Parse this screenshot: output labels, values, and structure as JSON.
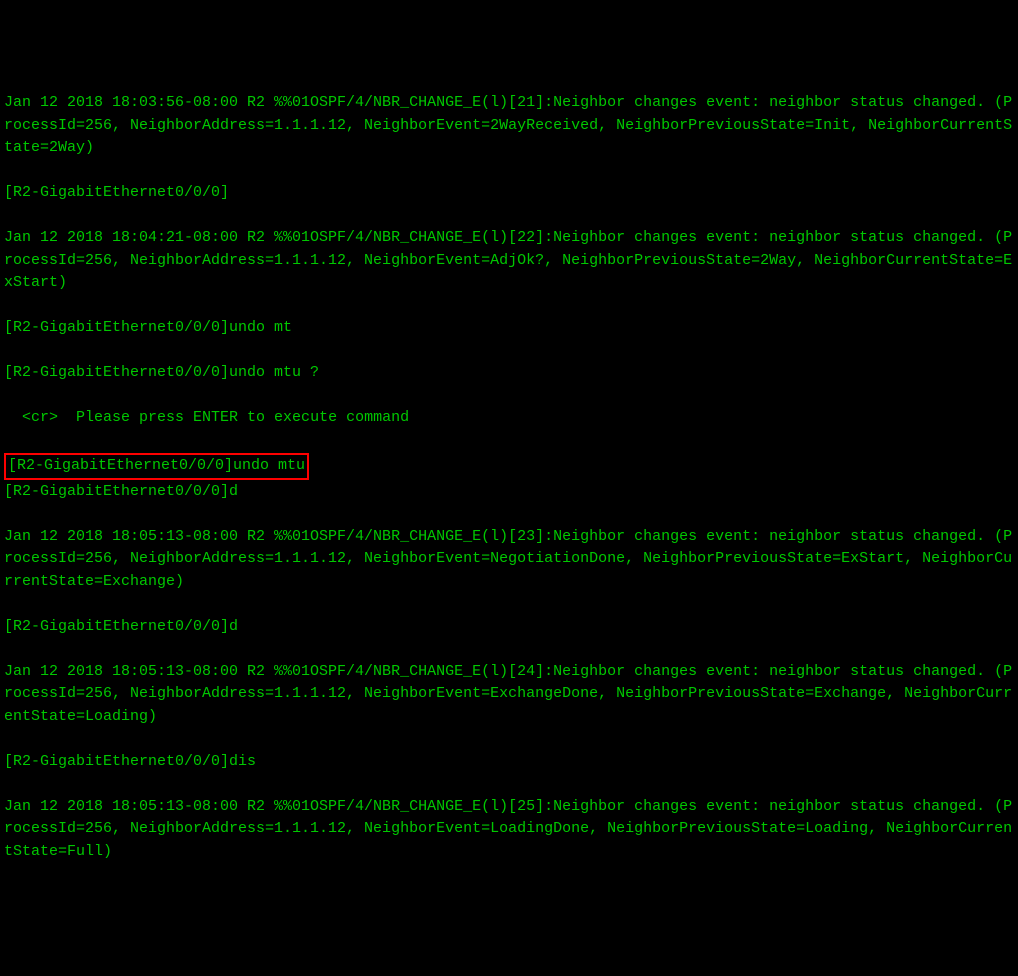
{
  "lines": {
    "l1": "Jan 12 2018 18:03:56-08:00 R2 %%01OSPF/4/NBR_CHANGE_E(l)[21]:Neighbor changes event: neighbor status changed. (ProcessId=256, NeighborAddress=1.1.1.12, NeighborEvent=2WayReceived, NeighborPreviousState=Init, NeighborCurrentState=2Way)",
    "l2": "[R2-GigabitEthernet0/0/0]",
    "l3": "Jan 12 2018 18:04:21-08:00 R2 %%01OSPF/4/NBR_CHANGE_E(l)[22]:Neighbor changes event: neighbor status changed. (ProcessId=256, NeighborAddress=1.1.1.12, NeighborEvent=AdjOk?, NeighborPreviousState=2Way, NeighborCurrentState=ExStart)",
    "l4": "[R2-GigabitEthernet0/0/0]undo mt",
    "l5": "[R2-GigabitEthernet0/0/0]undo mtu ?",
    "l6": "  <cr>  Please press ENTER to execute command",
    "l7": "[R2-GigabitEthernet0/0/0]undo mtu",
    "l8": "[R2-GigabitEthernet0/0/0]d",
    "l9": "Jan 12 2018 18:05:13-08:00 R2 %%01OSPF/4/NBR_CHANGE_E(l)[23]:Neighbor changes event: neighbor status changed. (ProcessId=256, NeighborAddress=1.1.1.12, NeighborEvent=NegotiationDone, NeighborPreviousState=ExStart, NeighborCurrentState=Exchange)",
    "l10": "[R2-GigabitEthernet0/0/0]d",
    "l11": "Jan 12 2018 18:05:13-08:00 R2 %%01OSPF/4/NBR_CHANGE_E(l)[24]:Neighbor changes event: neighbor status changed. (ProcessId=256, NeighborAddress=1.1.1.12, NeighborEvent=ExchangeDone, NeighborPreviousState=Exchange, NeighborCurrentState=Loading)",
    "l12": "[R2-GigabitEthernet0/0/0]dis",
    "l13": "Jan 12 2018 18:05:13-08:00 R2 %%01OSPF/4/NBR_CHANGE_E(l)[25]:Neighbor changes event: neighbor status changed. (ProcessId=256, NeighborAddress=1.1.1.12, NeighborEvent=LoadingDone, NeighborPreviousState=Loading, NeighborCurrentState=Full)"
  }
}
